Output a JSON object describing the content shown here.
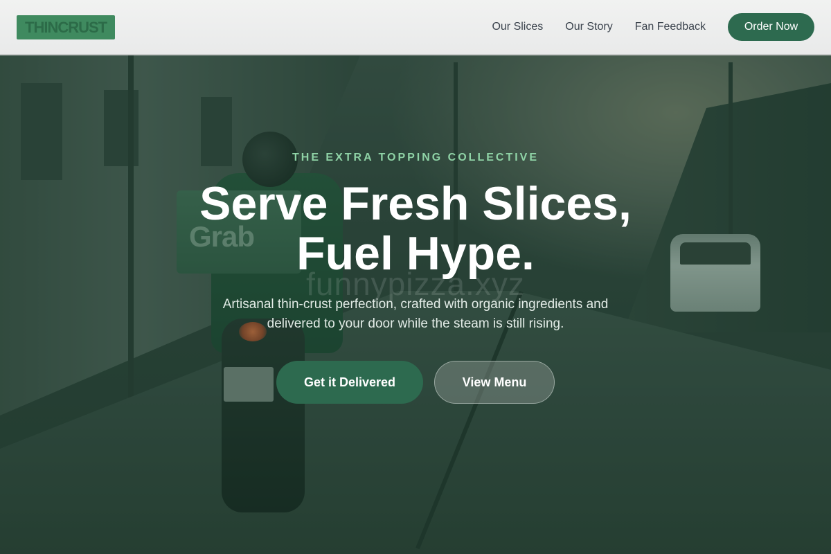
{
  "header": {
    "logo": "THINCRUST",
    "nav": [
      {
        "label": "Our Slices"
      },
      {
        "label": "Our Story"
      },
      {
        "label": "Fan Feedback"
      }
    ],
    "cta": "Order Now"
  },
  "hero": {
    "eyebrow": "THE EXTRA TOPPING COLLECTIVE",
    "headline_line1": "Serve Fresh Slices,",
    "headline_line2": "Fuel Hype.",
    "watermark": "funnypizza.xyz",
    "subtext": "Artisanal thin-crust perfection, crafted with organic ingredients and delivered to your door while the steam is still rising.",
    "primary_button": "Get it Delivered",
    "secondary_button": "View Menu",
    "photo_box_text": "Grab"
  },
  "colors": {
    "brand_green": "#2d6a4f",
    "eyebrow_green": "#8fd3a6",
    "overlay": "#143c28"
  }
}
